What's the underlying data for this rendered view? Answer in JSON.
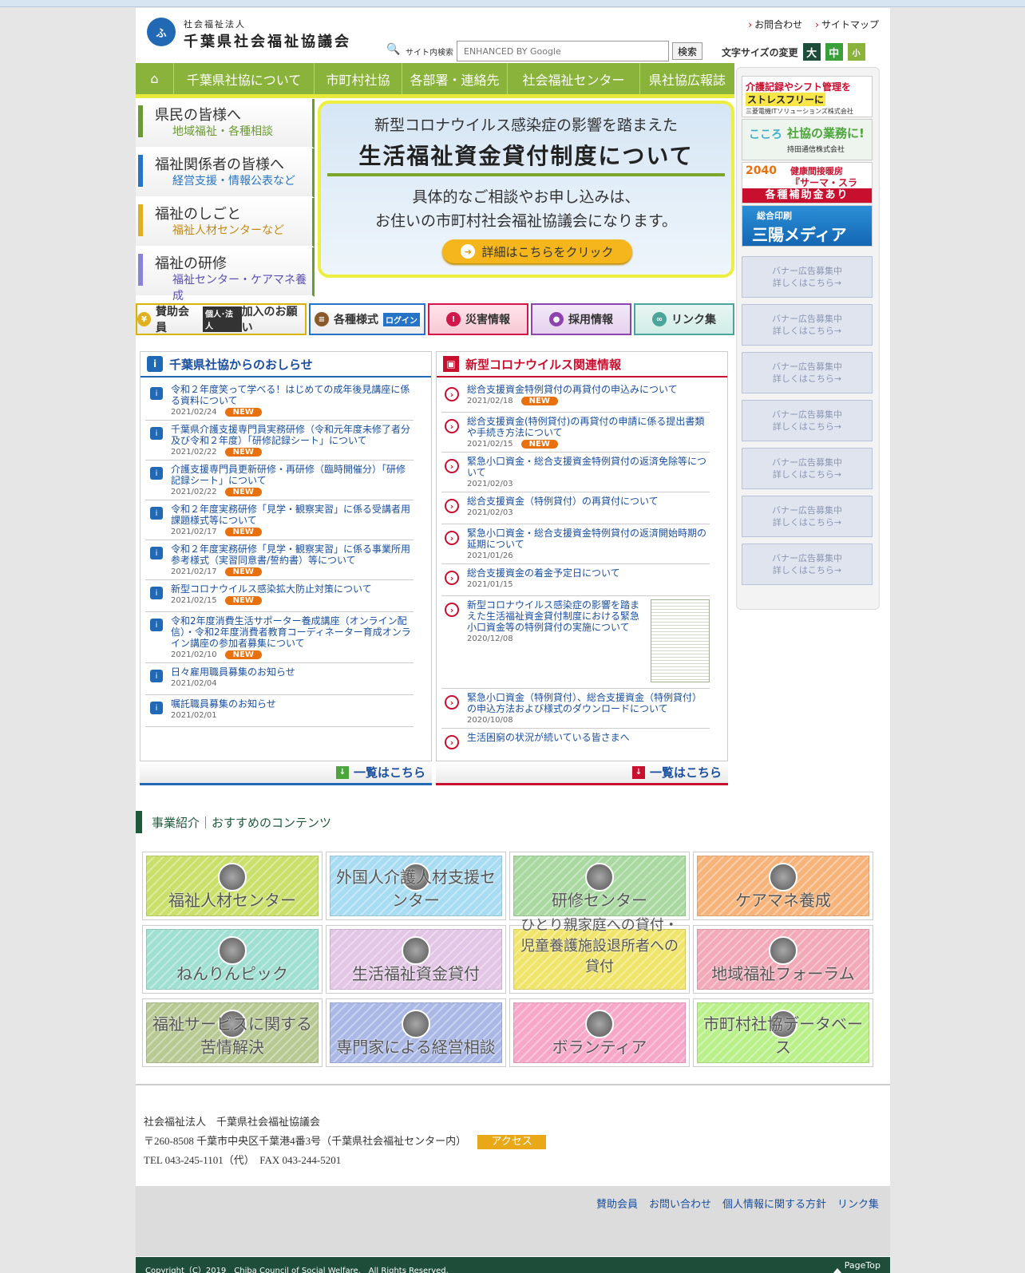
{
  "header": {
    "logo_mark": "ふ",
    "logo_sub": "社会福祉法人",
    "logo_main": "千葉県社会福祉協議会",
    "links": [
      "お問合わせ",
      "サイトマップ"
    ],
    "search_label": "サイト内検索",
    "search_placeholder": "ENHANCED BY Google",
    "search_button": "検索",
    "fontsize_label": "文字サイズの変更",
    "fontsize_options": [
      "大",
      "中",
      "小"
    ]
  },
  "nav": {
    "home_icon": "home-icon",
    "items": [
      "千葉県社協について",
      "市町村社協",
      "各部署・連絡先",
      "社会福祉センター",
      "県社協広報誌"
    ]
  },
  "left_menu": [
    {
      "title": "県民の皆様へ",
      "sub": "地域福祉・各種相談",
      "color": "#6a9a34"
    },
    {
      "title": "福祉関係者の皆様へ",
      "sub": "経営支援・情報公表など",
      "color": "#2574c5"
    },
    {
      "title": "福祉のしごと",
      "sub": "福祉人材センターなど",
      "color": "#c48a10"
    },
    {
      "title": "福祉の研修",
      "sub": "福祉センター・ケアマネ養成",
      "color": "#5a4fb0"
    }
  ],
  "banner": {
    "line1": "新型コロナウイルス感染症の影響を踏まえた",
    "line2": "生活福祉資金貸付制度について",
    "line3": "具体的なご相談やお申し込みは、",
    "line4": "お住いの市町村社会福祉協議会になります。",
    "button": "詳細はこちらをクリック"
  },
  "quick_buttons": [
    {
      "label": "賛助会員",
      "tag": "個人･法人",
      "label2": "加入のお願い",
      "color": "#d9b400"
    },
    {
      "label": "各種様式",
      "tag": "ログイン",
      "color": "#2574c5"
    },
    {
      "label": "災害情報",
      "color": "#d2174a"
    },
    {
      "label": "採用情報",
      "color": "#8e44ad"
    },
    {
      "label": "リンク集",
      "color": "#4aa59a"
    }
  ],
  "news": {
    "title": "千葉県社協からのおしらせ",
    "more": "一覧はこちら",
    "items": [
      {
        "title": "令和２年度笑って学べる！はじめての成年後見講座に係る資料について",
        "date": "2021/02/24",
        "new": "NEW"
      },
      {
        "title": "千葉県介護支援専門員実務研修（令和元年度未修了者分及び令和２年度）「研修記録シート」について",
        "date": "2021/02/22",
        "new": "NEW"
      },
      {
        "title": "介護支援専門員更新研修・再研修（臨時開催分）「研修記録シート」について",
        "date": "2021/02/22",
        "new": "NEW"
      },
      {
        "title": "令和２年度実務研修「見学・観察実習」に係る受講者用課題様式等について",
        "date": "2021/02/17",
        "new": "NEW"
      },
      {
        "title": "令和２年度実務研修「見学・観察実習」に係る事業所用参考様式（実習同意書/誓約書）等について",
        "date": "2021/02/17",
        "new": "NEW"
      },
      {
        "title": "新型コロナウイルス感染拡大防止対策について",
        "date": "2021/02/15",
        "new": "NEW"
      },
      {
        "title": "令和2年度消費生活サポーター養成講座（オンライン配信）・令和2年度消費者教育コーディネーター育成オンライン講座の参加者募集について",
        "date": "2021/02/10",
        "new": "NEW"
      },
      {
        "title": "日々雇用職員募集のお知らせ",
        "date": "2021/02/04",
        "new": ""
      },
      {
        "title": "嘱託職員募集のお知らせ",
        "date": "2021/02/01",
        "new": ""
      }
    ]
  },
  "covid": {
    "title": "新型コロナウイルス関連情報",
    "more": "一覧はこちら",
    "items": [
      {
        "title": "総合支援資金特例貸付の再貸付の申込みについて",
        "date": "2021/02/18",
        "new": "NEW"
      },
      {
        "title": "総合支援資金(特例貸付)の再貸付の申請に係る提出書類や手続き方法について",
        "date": "2021/02/15",
        "new": "NEW"
      },
      {
        "title": "緊急小口資金・総合支援資金特例貸付の返済免除等について",
        "date": "2021/02/03",
        "new": ""
      },
      {
        "title": "総合支援資金（特例貸付）の再貸付について",
        "date": "2021/02/03",
        "new": ""
      },
      {
        "title": "緊急小口資金・総合支援資金特例貸付の返済開始時期の延期について",
        "date": "2021/01/26",
        "new": ""
      },
      {
        "title": "総合支援資金の着金予定日について",
        "date": "2021/01/15",
        "new": ""
      },
      {
        "title": "新型コロナウイルス感染症の影響を踏まえた生活福祉資金貸付制度における緊急小口資金等の特例貸付の実施について",
        "date": "2020/12/08",
        "new": "",
        "thumb": true
      },
      {
        "title": "緊急小口資金（特例貸付）、総合支援資金（特例貸付）の申込方法および様式のダウンロードについて",
        "date": "2020/10/08",
        "new": ""
      },
      {
        "title": "生活困窮の状況が続いている皆さまへ",
        "date": "",
        "new": ""
      }
    ]
  },
  "ads": [
    {
      "type": "care",
      "a": "介護記録やシフト管理を",
      "b": "ストレスフリーに",
      "c": "三菱電機ITソリューションズ株式会社"
    },
    {
      "type": "kokoro",
      "a": "社協の業務に!",
      "b": "持田通信株式会社",
      "c": "こころ"
    },
    {
      "type": "therma",
      "a": "2040",
      "b": "健康間接暖房",
      "c": "『サーマ・スラブ』",
      "d": "各種補助金あり"
    },
    {
      "type": "sanyo",
      "a": "総合印刷",
      "b": "三陽メディア"
    }
  ],
  "ad_placeholder": "バナー広告募集中\n詳しくはこちら→",
  "section2": {
    "title": "事業紹介｜おすすめのコンテンツ",
    "tiles": [
      {
        "label": "福祉人材センター",
        "color": "#c9e06a"
      },
      {
        "label": "外国人介護人材支援センター",
        "color": "#a8dcf2"
      },
      {
        "label": "研修センター",
        "color": "#a9d9a1"
      },
      {
        "label": "ケアマネ養成",
        "color": "#f7b47a"
      },
      {
        "label": "ねんりんピック",
        "color": "#9fe0d2"
      },
      {
        "label": "生活福祉資金貸付",
        "color": "#e3c6e6"
      },
      {
        "label": "ひとり親家庭への貸付・児童養護施設退所者への貸付",
        "color": "#f0e56a"
      },
      {
        "label": "地域福祉フォーラム",
        "color": "#f2a9b8"
      },
      {
        "label": "福祉サービスに関する苦情解決",
        "color": "#b9c994"
      },
      {
        "label": "専門家による経営相談",
        "color": "#aab8e6"
      },
      {
        "label": "ボランティア",
        "color": "#f7a7c8"
      },
      {
        "label": "市町村社協データベース",
        "color": "#baf08a"
      }
    ]
  },
  "footer": {
    "org": "社会福祉法人　千葉県社会福祉協議会",
    "address": "〒260-8508 千葉市中央区千葉港4番3号（千葉県社会福祉センター内）",
    "access": "アクセス",
    "tel": "TEL 043-245-1101（代）　FAX 043-244-5201",
    "links": [
      "賛助会員",
      "お問い合わせ",
      "個人情報に関する方針",
      "リンク集"
    ],
    "copyright": "Copyright（C）2019　Chiba Council of Social Welfare.　All Rights Reserved.",
    "pagetop": "PageTop"
  }
}
